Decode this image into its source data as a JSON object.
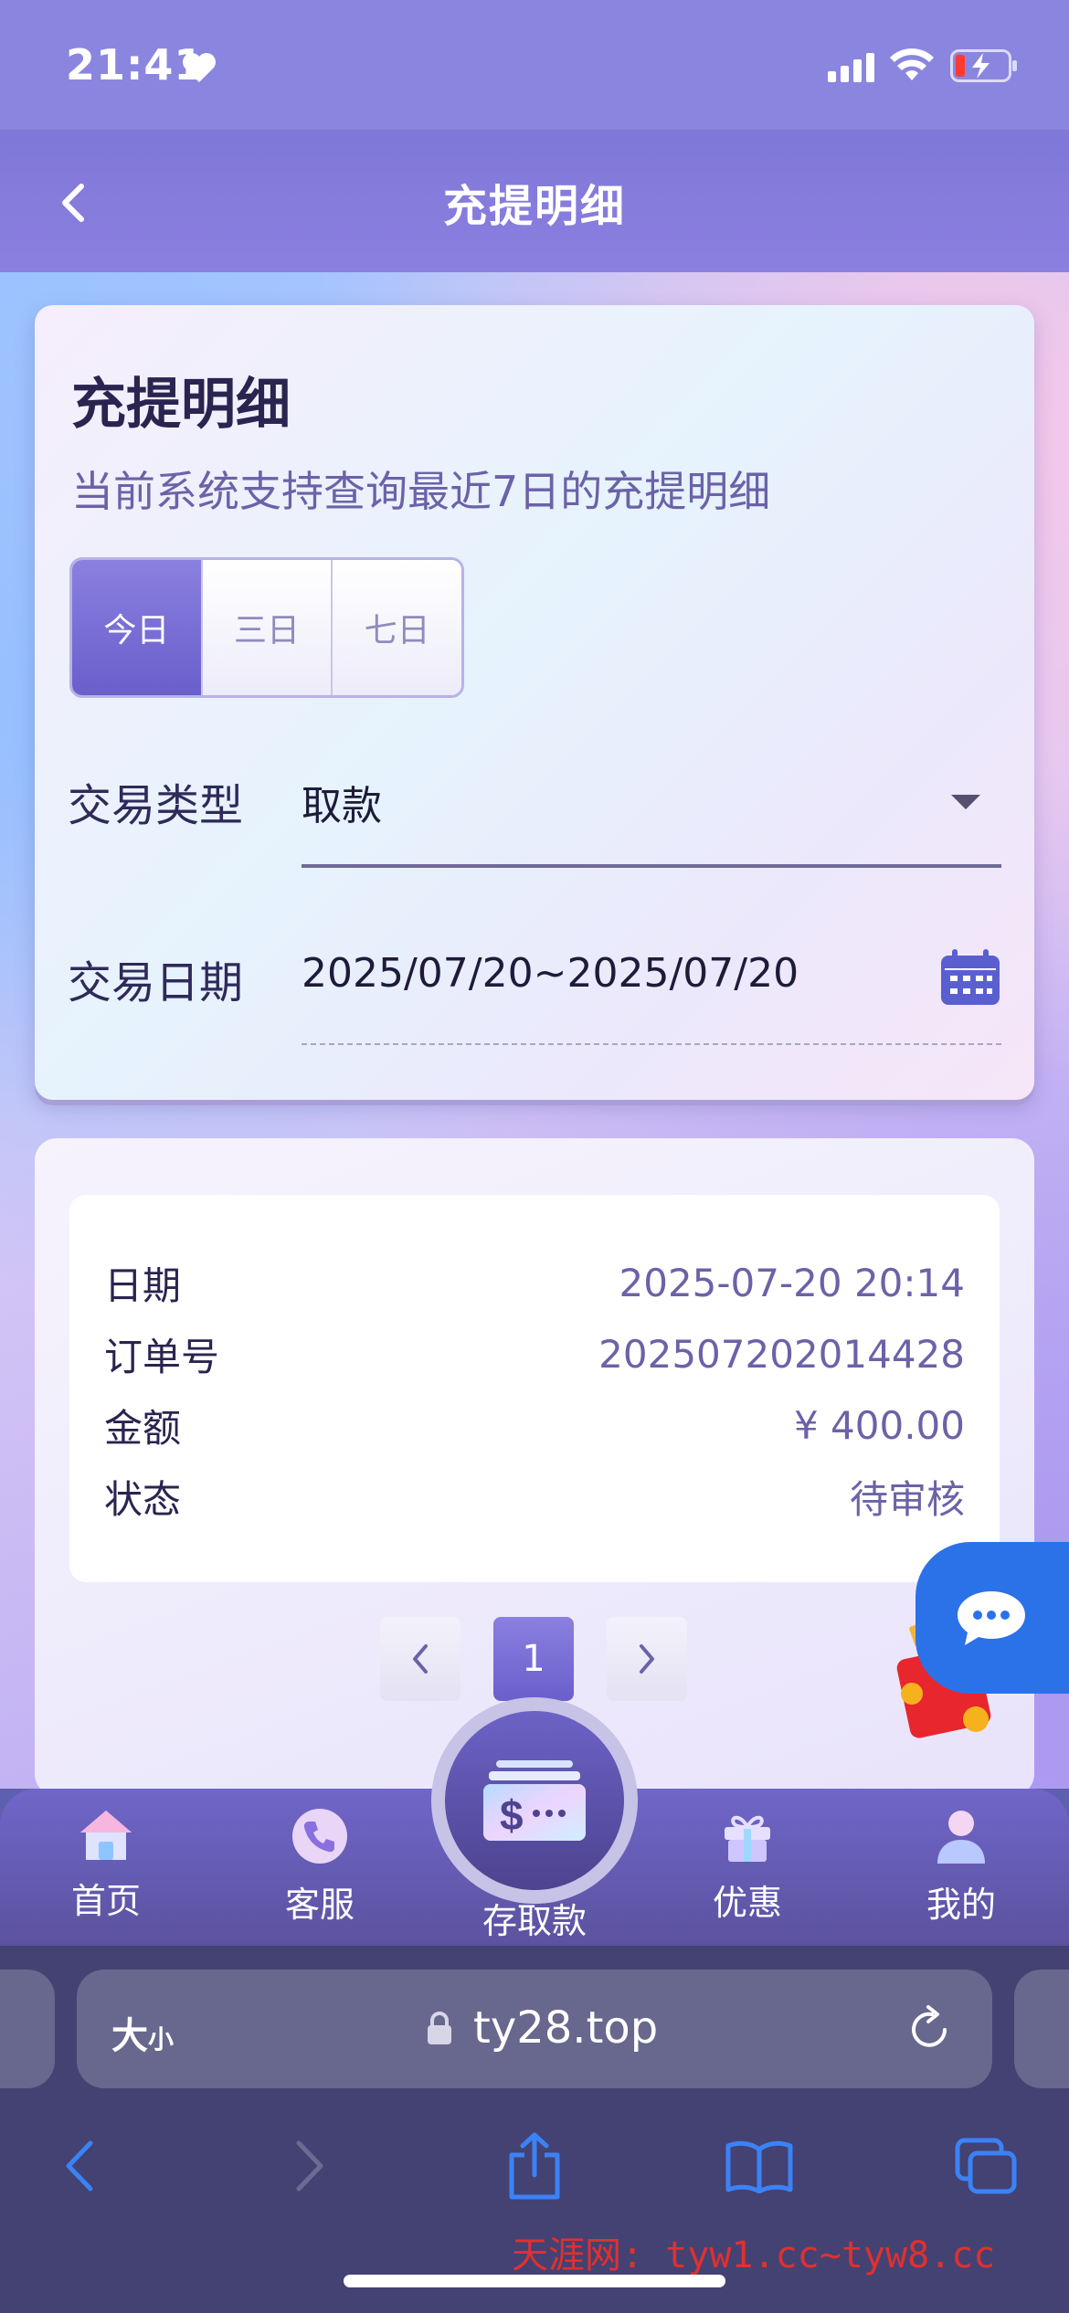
{
  "status_bar": {
    "time": "21:41"
  },
  "header": {
    "title": "充提明细"
  },
  "filter": {
    "title": "充提明细",
    "subtitle": "当前系统支持查询最近7日的充提明细",
    "ranges": [
      "今日",
      "三日",
      "七日"
    ],
    "active_range": "今日",
    "type_label": "交易类型",
    "type_value": "取款",
    "date_label": "交易日期",
    "date_value": "2025/07/20~2025/07/20"
  },
  "records": [
    {
      "date_label": "日期",
      "date": "2025-07-20 20:14",
      "order_label": "订单号",
      "order_no": "202507202014428",
      "amount_label": "金额",
      "amount": "¥ 400.00",
      "status_label": "状态",
      "status": "待审核"
    }
  ],
  "pagination": {
    "current_page": "1"
  },
  "tabbar": {
    "home": "首页",
    "service": "客服",
    "deposit": "存取款",
    "promo": "优惠",
    "mine": "我的"
  },
  "browser": {
    "text_size": "大",
    "text_size_small": "小",
    "url": "ty28.top"
  },
  "watermark": "天涯网: tyw1.cc~tyw8.cc",
  "colors": {
    "accent": "#6a5fcb",
    "chat_button": "#2b72e8",
    "header": "#8a86df"
  }
}
